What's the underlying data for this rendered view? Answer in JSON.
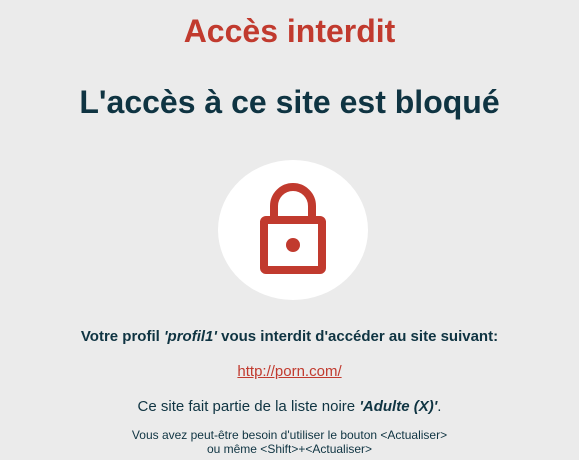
{
  "header": {
    "title": "Accès interdit",
    "subtitle": "L'accès à ce site est bloqué"
  },
  "icons": {
    "lock": "lock-icon"
  },
  "message": {
    "profile_prefix": "Votre profil ",
    "profile_name": "'profil1'",
    "profile_suffix": " vous interdit d'accéder au site suivant:",
    "blocked_url": "http://porn.com/",
    "blacklist_prefix": "Ce site fait partie de la liste noire ",
    "blacklist_name": "'Adulte (X)'",
    "blacklist_suffix": ".",
    "hint_line1": "Vous avez peut-être besoin d'utiliser le bouton <Actualiser>",
    "hint_line2": "ou même <Shift>+<Actualiser>"
  },
  "colors": {
    "accent_red": "#c13a2e",
    "text_dark": "#0f3442",
    "background": "#ebebeb",
    "circle": "#ffffff"
  }
}
